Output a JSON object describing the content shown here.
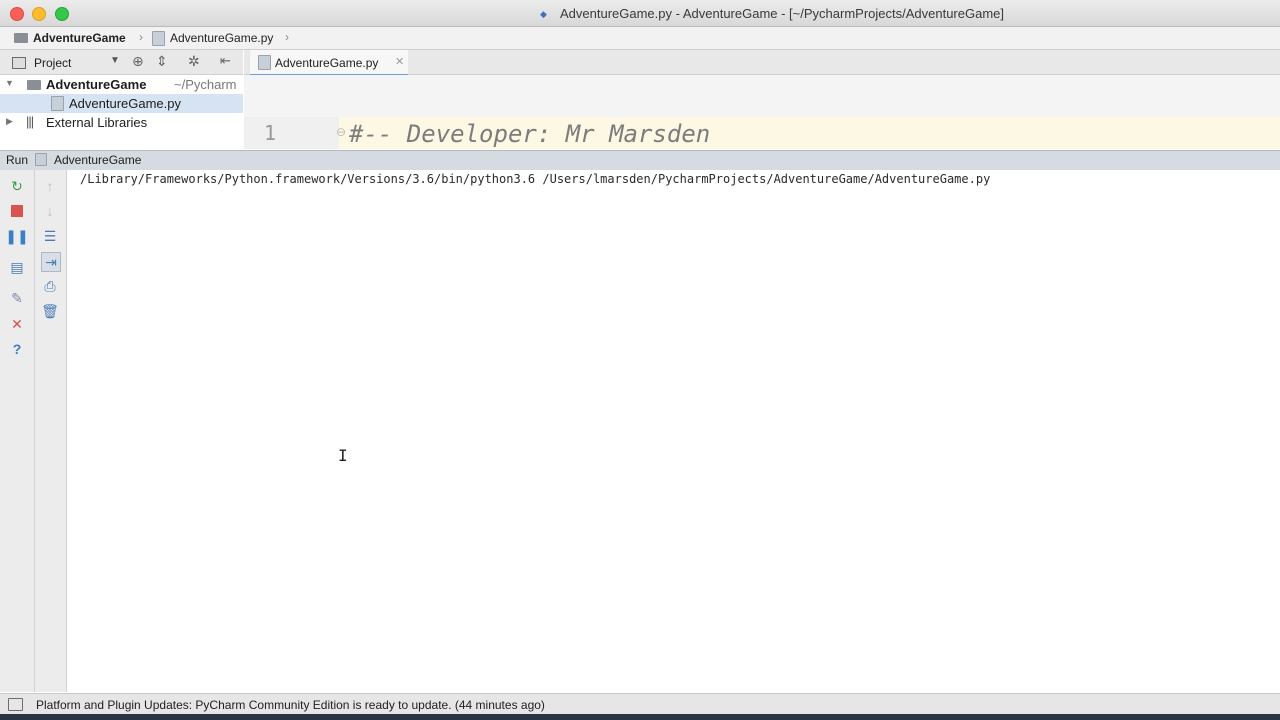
{
  "window": {
    "title": "AdventureGame.py - AdventureGame - [~/PycharmProjects/AdventureGame]"
  },
  "navbar": {
    "project": "AdventureGame",
    "file": "AdventureGame.py"
  },
  "project_panel": {
    "header_label": "Project",
    "tree": [
      {
        "label": "AdventureGame",
        "suffix": "~/Pycharm"
      },
      {
        "label": "AdventureGame.py"
      },
      {
        "label": "External Libraries"
      }
    ]
  },
  "editor": {
    "tab_label": "AdventureGame.py",
    "line_number": "1",
    "code": "#-- Developer: Mr Marsden"
  },
  "run_panel": {
    "label": "Run",
    "config": "AdventureGame",
    "output": "/Library/Frameworks/Python.framework/Versions/3.6/bin/python3.6 /Users/lmarsden/PycharmProjects/AdventureGame/AdventureGame.py"
  },
  "status": {
    "text": "Platform and Plugin Updates: PyCharm Community Edition is ready to update. (44 minutes ago)"
  },
  "colors": {
    "close": "#fc5f57",
    "minimize": "#fdbc2e",
    "maximize": "#34c84a",
    "stop": "#d9534f",
    "run": "#3d9c46",
    "selection": "#d6e3f2"
  }
}
